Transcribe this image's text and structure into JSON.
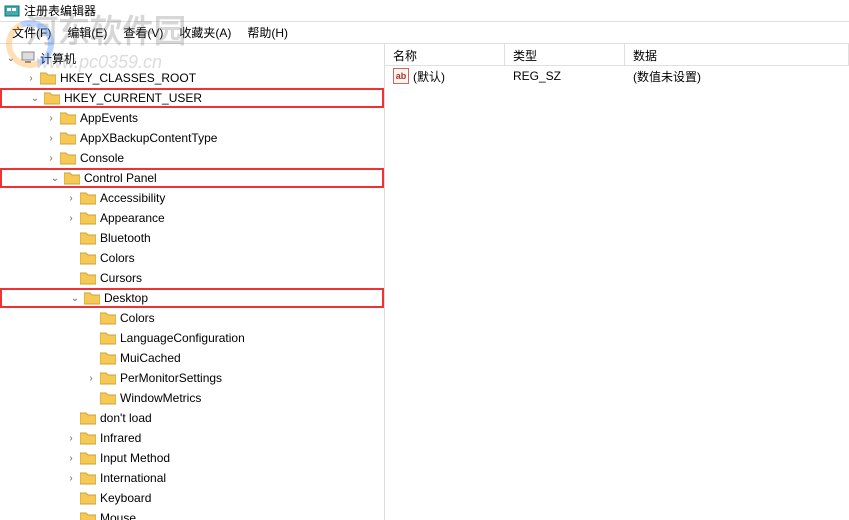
{
  "window": {
    "title": "注册表编辑器"
  },
  "menu": {
    "file": "文件(F)",
    "edit": "编辑(E)",
    "view": "查看(V)",
    "fav": "收藏夹(A)",
    "help": "帮助(H)"
  },
  "list": {
    "headers": {
      "name": "名称",
      "type": "类型",
      "data": "数据"
    },
    "rows": [
      {
        "icon": "ab",
        "name": "(默认)",
        "type": "REG_SZ",
        "data": "(数值未设置)"
      }
    ]
  },
  "tree": {
    "computer": "计算机",
    "hkcr": "HKEY_CLASSES_ROOT",
    "hkcu": "HKEY_CURRENT_USER",
    "appevents": "AppEvents",
    "appxbackup": "AppXBackupContentType",
    "console": "Console",
    "controlpanel": "Control Panel",
    "accessibility": "Accessibility",
    "appearance": "Appearance",
    "bluetooth": "Bluetooth",
    "colors": "Colors",
    "cursors": "Cursors",
    "desktop": "Desktop",
    "desktop_colors": "Colors",
    "langconfig": "LanguageConfiguration",
    "muicached": "MuiCached",
    "permonitor": "PerMonitorSettings",
    "windowmetrics": "WindowMetrics",
    "dontload": "don't load",
    "infrared": "Infrared",
    "inputmethod": "Input Method",
    "international": "International",
    "keyboard": "Keyboard",
    "mouse": "Mouse"
  },
  "watermark": {
    "text": "河东软件园",
    "url": "www.pc0359.cn"
  }
}
